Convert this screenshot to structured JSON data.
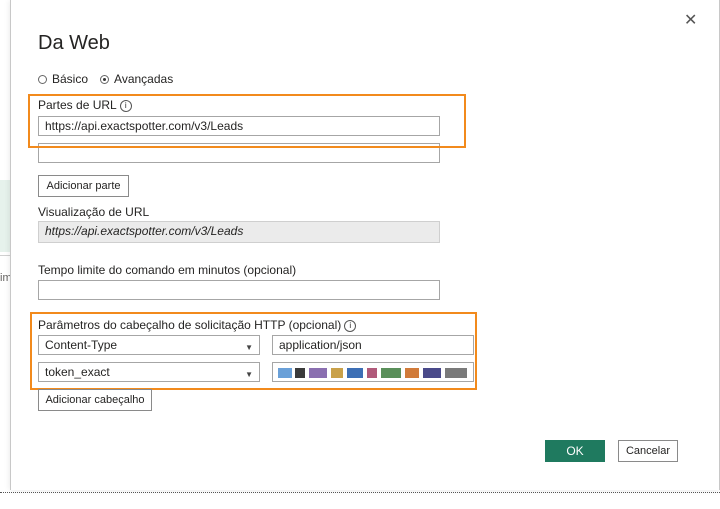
{
  "background": {
    "side_text": "im"
  },
  "dialog": {
    "title": "Da Web",
    "close_glyph": "✕",
    "mode": {
      "basic_label": "Básico",
      "advanced_label": "Avançadas",
      "selected": "Avançadas"
    },
    "url_parts": {
      "label": "Partes de URL",
      "info_glyph": "i",
      "parts": [
        "https://api.exactspotter.com/v3/Leads",
        ""
      ],
      "add_part_label": "Adicionar parte"
    },
    "url_preview": {
      "label": "Visualização de URL",
      "value": "https://api.exactspotter.com/v3/Leads"
    },
    "timeout": {
      "label": "Tempo limite do comando em minutos (opcional)",
      "value": ""
    },
    "headers": {
      "label": "Parâmetros do cabeçalho de solicitação HTTP (opcional)",
      "info_glyph": "i",
      "rows": [
        {
          "name": "Content-Type",
          "value": "application/json"
        },
        {
          "name": "token_exact",
          "value": "",
          "value_obscured": true
        }
      ],
      "add_header_label": "Adicionar cabeçalho"
    },
    "ok_label": "OK",
    "cancel_label": "Cancelar"
  },
  "colors": {
    "highlight": "#f28a1c",
    "primary": "#1f7a5f"
  },
  "icons": [
    "close-icon",
    "info-icon",
    "chevron-down-icon",
    "radio-icon"
  ]
}
